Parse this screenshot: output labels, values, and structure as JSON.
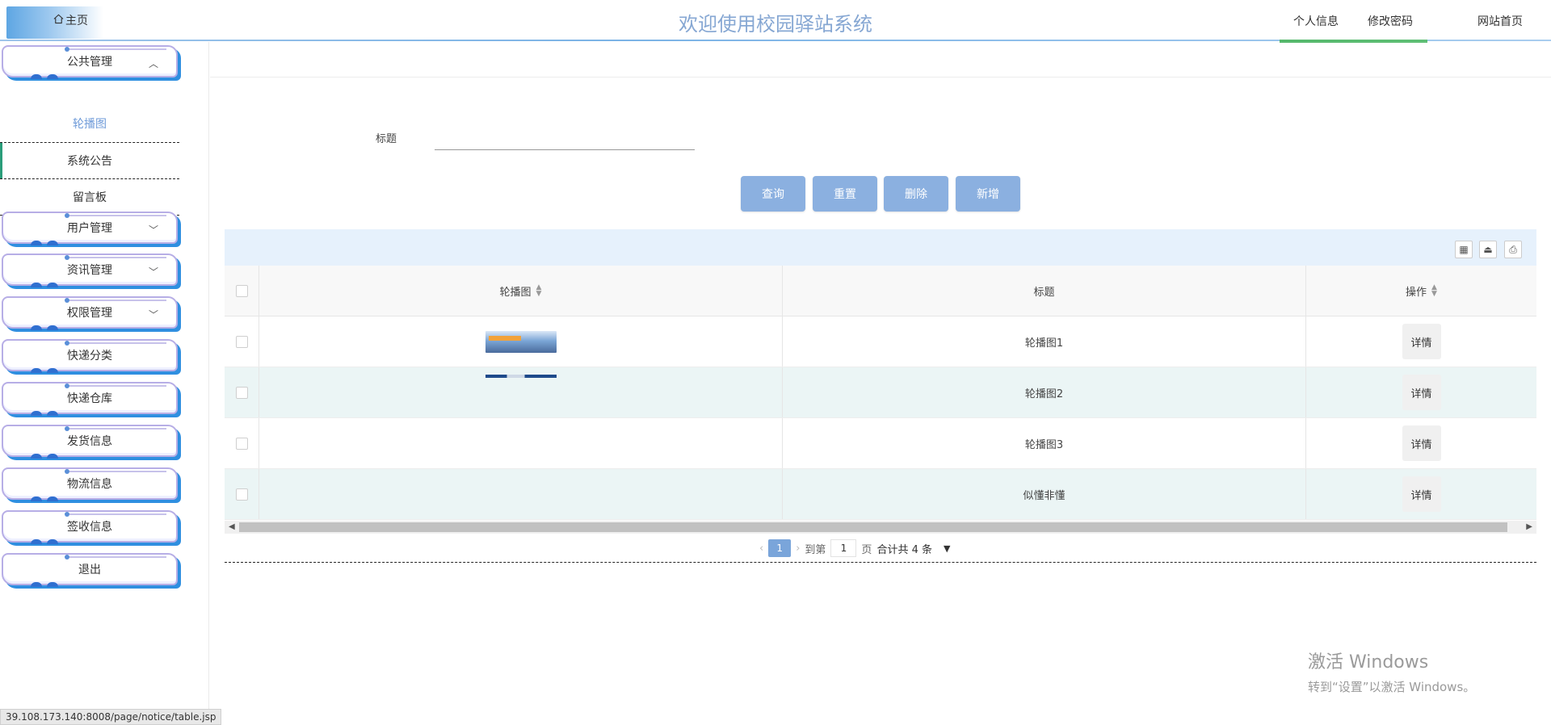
{
  "header": {
    "home_label": "主页",
    "title": "欢迎使用校园驿站系统",
    "links": [
      "个人信息",
      "修改密码",
      "网站首页"
    ]
  },
  "sidebar": {
    "groups": [
      {
        "label": "公共管理",
        "expanded": true,
        "children": [
          "轮播图",
          "系统公告",
          "留言板"
        ],
        "active_child": "轮播图",
        "selected_child": "系统公告"
      },
      {
        "label": "用户管理",
        "expanded": false
      },
      {
        "label": "资讯管理",
        "expanded": false
      },
      {
        "label": "权限管理",
        "expanded": false
      },
      {
        "label": "快递分类"
      },
      {
        "label": "快递仓库"
      },
      {
        "label": "发货信息"
      },
      {
        "label": "物流信息"
      },
      {
        "label": "签收信息"
      },
      {
        "label": "退出"
      }
    ]
  },
  "search": {
    "label": "标题",
    "value": ""
  },
  "actions": {
    "query": "查询",
    "reset": "重置",
    "delete": "删除",
    "add": "新增"
  },
  "table": {
    "columns": [
      "轮播图",
      "标题",
      "操作"
    ],
    "rows": [
      {
        "title": "轮播图1",
        "has_image": true,
        "action": "详情"
      },
      {
        "title": "轮播图2",
        "has_image": true,
        "action": "详情"
      },
      {
        "title": "轮播图3",
        "has_image": false,
        "action": "详情"
      },
      {
        "title": "似懂非懂",
        "has_image": false,
        "action": "详情"
      }
    ]
  },
  "pagination": {
    "current_page": "1",
    "goto_label": "到第",
    "page_input": "1",
    "page_unit": "页",
    "total": "合计共 4 条"
  },
  "watermark": {
    "line1": "激活 Windows",
    "line2": "转到“设置”以激活 Windows。"
  },
  "status_url": "39.108.173.140:8008/page/notice/table.jsp",
  "colors": {
    "title": "#86a7d3",
    "button": "#8bb0e0",
    "toolbar_bg": "#e6f1fc",
    "row_alt": "#ebf5f5",
    "active_accent": "#2a9d7a"
  }
}
